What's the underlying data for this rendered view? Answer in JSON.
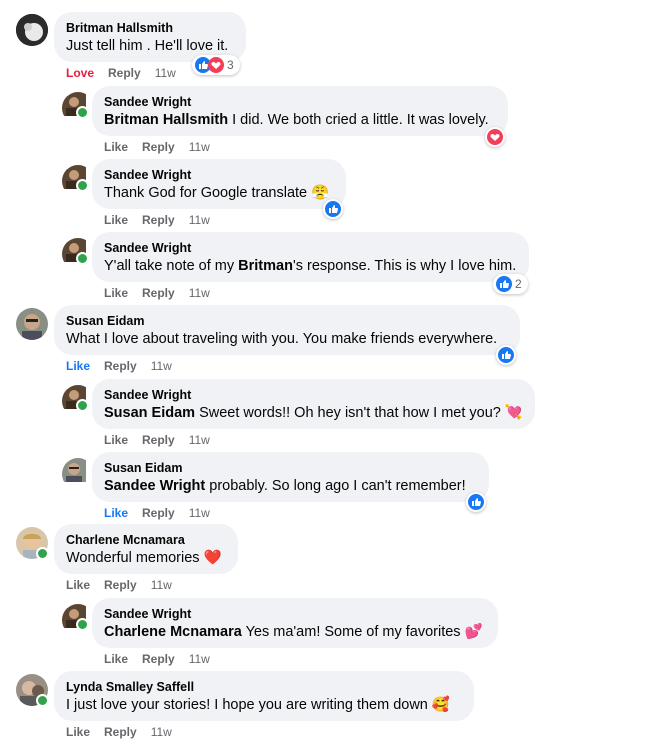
{
  "actions": {
    "like": "Like",
    "love": "Love",
    "reply": "Reply",
    "time": "11w"
  },
  "comments": [
    {
      "author": "Britman Hallsmith",
      "text": "Just tell him . He'll love it.",
      "reaction_count": "3"
    },
    {
      "author": "Sandee Wright",
      "mention": "Britman Hallsmith",
      "text": " I did. We both cried a little. It was lovely."
    },
    {
      "author": "Sandee Wright",
      "text": "Thank God for Google translate 😤"
    },
    {
      "author": "Sandee Wright",
      "text_a": "Y'all take note of my ",
      "mention": "Britman",
      "text_b": "'s response. This is why I love him.",
      "reaction_count": "2"
    },
    {
      "author": "Susan Eidam",
      "text": "What I love about traveling with you. You make friends everywhere."
    },
    {
      "author": "Sandee Wright",
      "mention": "Susan Eidam",
      "text": " Sweet words!! Oh hey isn't that how I met you? 💘"
    },
    {
      "author": "Susan Eidam",
      "mention": "Sandee Wright",
      "text": " probably. So long ago I can't remember!"
    },
    {
      "author": "Charlene Mcnamara",
      "text": "Wonderful memories ❤️"
    },
    {
      "author": "Sandee Wright",
      "mention": "Charlene Mcnamara",
      "text": " Yes ma'am! Some of my favorites 💕"
    },
    {
      "author": "Lynda Smalley Saffell",
      "text": "I just love your stories! I hope you are writing them down 🥰"
    }
  ],
  "colors": {
    "like_blue": "#1877f2",
    "love_red": "#f33e58",
    "bubble": "#f0f2f5",
    "meta_gray": "#65676b",
    "online": "#31a24c"
  }
}
